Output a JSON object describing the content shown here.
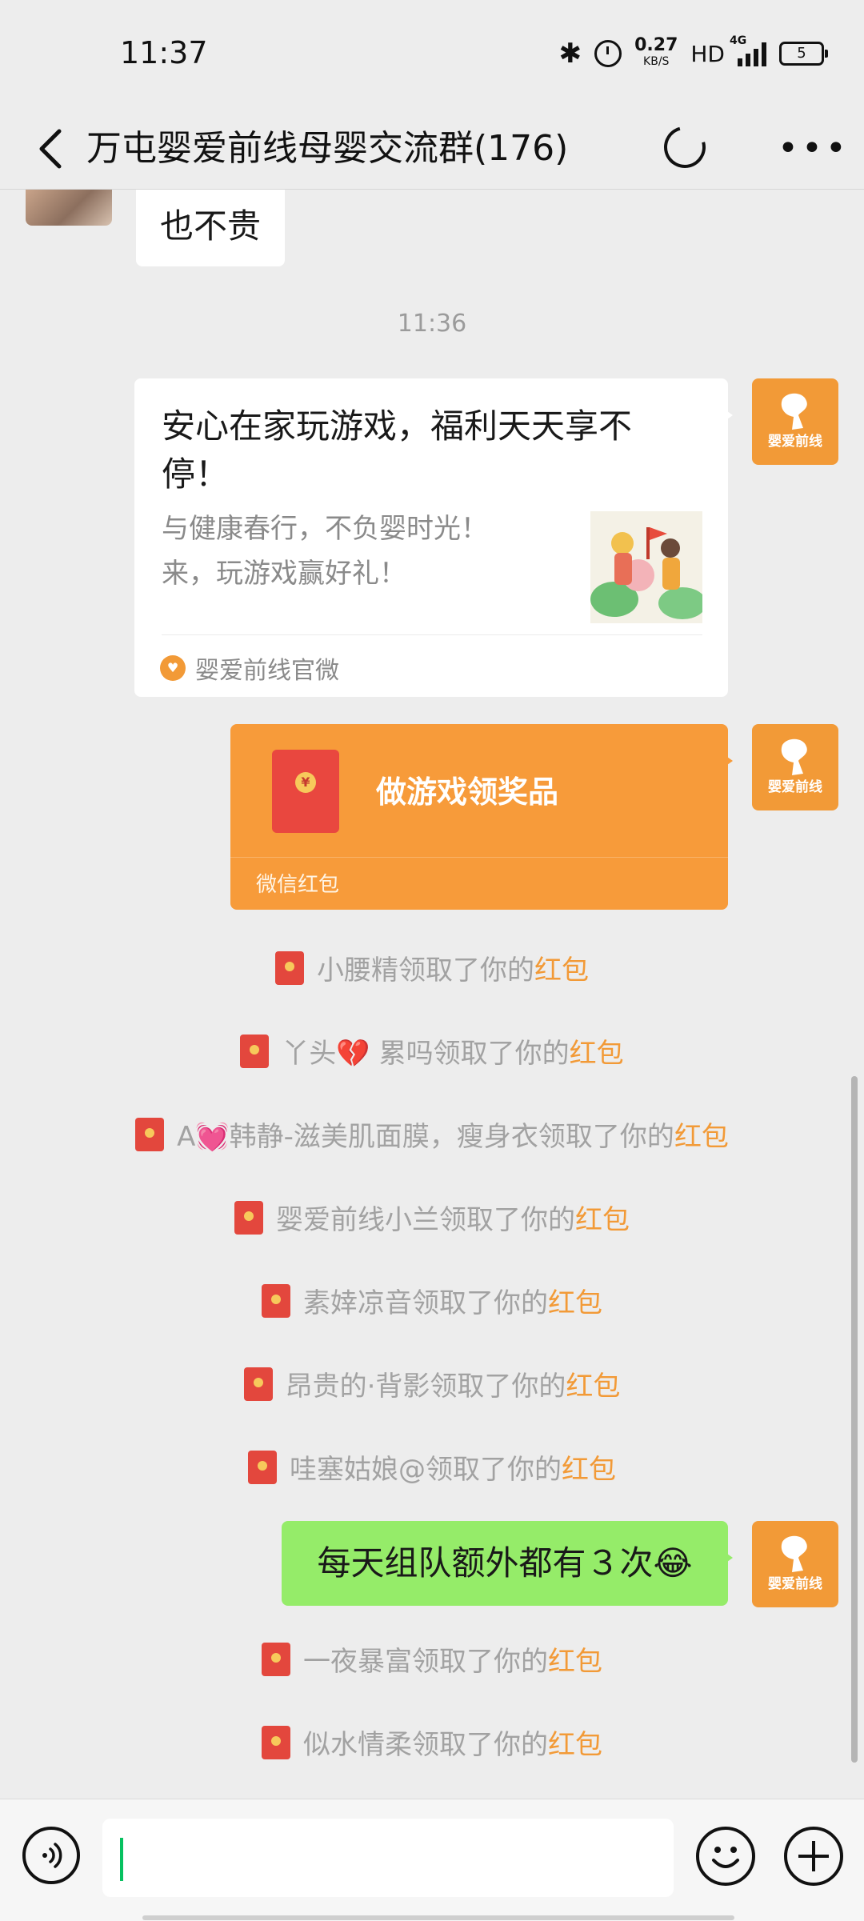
{
  "status_bar": {
    "time": "11:37",
    "net_speed": "0.27",
    "net_unit": "KB/S",
    "hd": "HD",
    "network": "4G",
    "battery": "5"
  },
  "nav": {
    "title": "万屯婴爱前线母婴交流群(176)"
  },
  "chat": {
    "prev_message": "也不贵",
    "timestamp": "11:36",
    "link_card": {
      "title": "安心在家玩游戏，福利天天享不停！",
      "description_line1": "与健康春行，不负婴时光！",
      "description_line2": "来，玩游戏赢好礼！",
      "source": "婴爱前线官微"
    },
    "red_packet": {
      "title": "做游戏领奖品",
      "footer": "微信红包"
    },
    "claim_link_text": "红包",
    "claims_before": [
      "小腰精领取了你的",
      "丫头💔 累吗领取了你的",
      "A💓韩静-滋美肌面膜，瘦身衣领取了你的",
      "婴爱前线小兰领取了你的",
      "素婞凉音领取了你的",
      "昂贵的·背影领取了你的",
      "哇塞姑娘@领取了你的"
    ],
    "my_message": "每天组队额外都有３次😂",
    "claims_after": [
      "一夜暴富领取了你的",
      "似水情柔领取了你的"
    ],
    "brand_avatar_text": "婴爱前线"
  },
  "colors": {
    "accent_orange": "#f29a37",
    "wechat_green": "#95ec69",
    "background": "#ededed"
  },
  "icons": [
    "back-arrow-icon",
    "loading-icon",
    "more-icon",
    "voice-icon",
    "emoji-icon",
    "plus-icon",
    "bluetooth-icon",
    "alarm-icon",
    "signal-icon",
    "battery-icon",
    "red-packet-icon"
  ]
}
